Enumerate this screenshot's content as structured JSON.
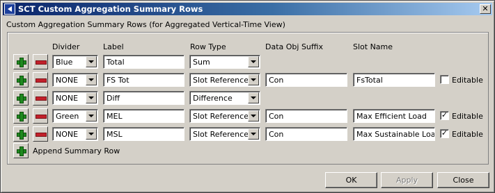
{
  "window": {
    "title": "SCT Custom Aggregation Summary Rows",
    "close_glyph": "✕"
  },
  "subtitle": "Custom Aggregation Summary Rows (for Aggregated Vertical-Time View)",
  "columns": {
    "divider": "Divider",
    "label": "Label",
    "row_type": "Row Type",
    "suffix": "Data Obj Suffix",
    "slot_name": "Slot Name"
  },
  "rows": [
    {
      "divider": "Blue",
      "label": "Total",
      "row_type": "Sum",
      "suffix": "",
      "slot": "",
      "editable_label": "",
      "editable": false
    },
    {
      "divider": "NONE",
      "label": "FS Tot",
      "row_type": "Slot Reference",
      "suffix": "Con",
      "slot": "FsTotal",
      "editable_label": "Editable",
      "editable": false
    },
    {
      "divider": "NONE",
      "label": "Diff",
      "row_type": "Difference",
      "suffix": "",
      "slot": "",
      "editable_label": "",
      "editable": false
    },
    {
      "divider": "Green",
      "label": "MEL",
      "row_type": "Slot Reference",
      "suffix": "Con",
      "slot": "Max Efficient Load",
      "editable_label": "Editable",
      "editable": true
    },
    {
      "divider": "NONE",
      "label": "MSL",
      "row_type": "Slot Reference",
      "suffix": "Con",
      "slot": "Max Sustainable Load",
      "editable_label": "Editable",
      "editable": true
    }
  ],
  "check_mark": "✓",
  "append_label": "Append Summary Row",
  "buttons": {
    "ok": "OK",
    "apply": "Apply",
    "close": "Close"
  }
}
